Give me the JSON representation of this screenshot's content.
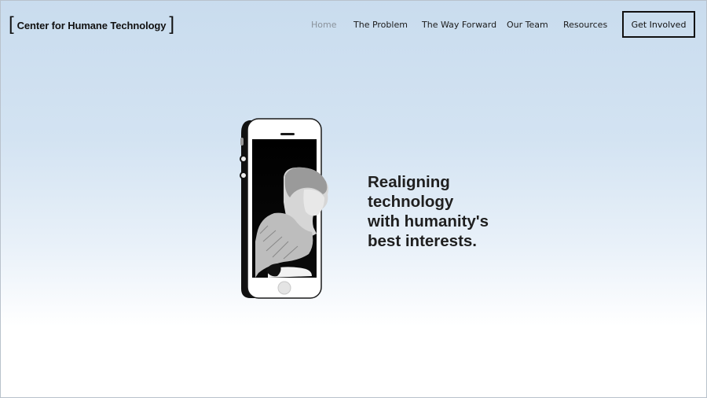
{
  "header": {
    "logo_text": "Center for Humane Technology",
    "nav": [
      {
        "label": "Home",
        "active": true
      },
      {
        "label": "The Problem",
        "active": false
      },
      {
        "label": "The Way Forward",
        "active": false
      },
      {
        "label": "Our Team",
        "active": false
      },
      {
        "label": "Resources",
        "active": false
      }
    ],
    "cta_label": "Get Involved"
  },
  "hero": {
    "headline": "Realigning\ntechnology\nwith humanity's\nbest interests.",
    "image_icon": "phone-with-woman-illustration"
  },
  "colors": {
    "sky_top": "#c9dcee",
    "text": "#1f1f1f",
    "nav_active": "#8a929b"
  }
}
